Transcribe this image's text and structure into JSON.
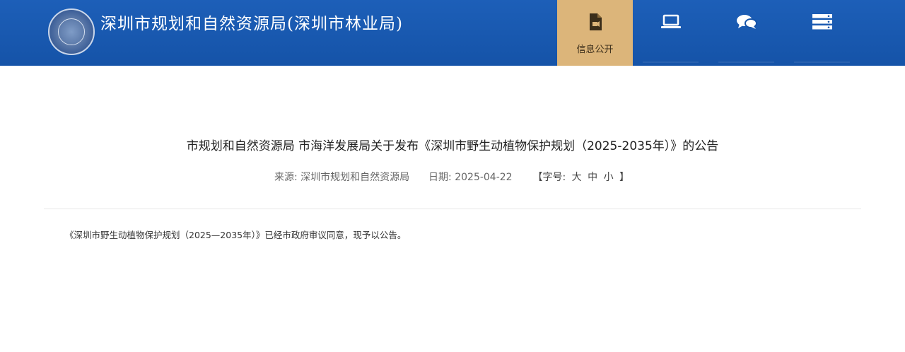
{
  "header": {
    "site_title": "深圳市规划和自然资源局(深圳市林业局)",
    "emblem": "city-emblem",
    "nav": [
      {
        "label": "信息公开",
        "icon": "document-icon",
        "active": true
      },
      {
        "label": "",
        "icon": "laptop-icon",
        "active": false
      },
      {
        "label": "",
        "icon": "chat-bubbles-icon",
        "active": false
      },
      {
        "label": "",
        "icon": "server-icon",
        "active": false
      }
    ]
  },
  "article": {
    "title": "市规划和自然资源局 市海洋发展局关于发布《深圳市野生动植物保护规划（2025-2035年）》的公告",
    "source_label": "来源:",
    "source_value": "深圳市规划和自然资源局",
    "date_label": "日期:",
    "date_value": "2025-04-22",
    "font_size_label": "【字号:",
    "font_size_large": "大",
    "font_size_medium": "中",
    "font_size_small": "小",
    "font_size_close": "】",
    "body": "《深圳市野生动植物保护规划（2025—2035年）》已经市政府审议同意，现予以公告。"
  },
  "colors": {
    "header_bg": "#1553a8",
    "active_tab_bg": "#dcb57a"
  }
}
